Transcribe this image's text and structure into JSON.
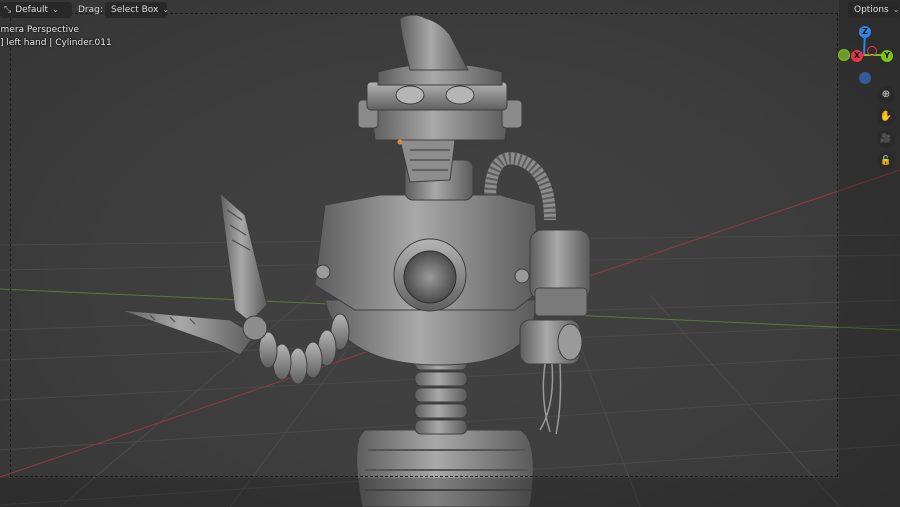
{
  "header": {
    "orientation": {
      "icon": "transform-orientation-icon",
      "label": "Default"
    },
    "drag_label": "Drag:",
    "select_mode": "Select Box",
    "options_label": "Options"
  },
  "overlay": {
    "view_name": "amera Perspective",
    "object_info": "] left hand | Cylinder.011"
  },
  "gizmo": {
    "axes": [
      {
        "label": "Z",
        "color": "#2f86e8"
      },
      {
        "label": "X",
        "color": "#e8344b"
      },
      {
        "label": "Y",
        "color": "#7fc21b"
      }
    ],
    "neg_colors": {
      "x": "#a33447",
      "y": "#6a9a2a",
      "z": "#335c99"
    }
  },
  "navigation_tools": [
    {
      "name": "zoom-icon",
      "glyph": "⊕"
    },
    {
      "name": "pan-hand-icon",
      "glyph": "✋"
    },
    {
      "name": "camera-view-icon",
      "glyph": "🎥"
    },
    {
      "name": "lock-camera-icon",
      "glyph": "🔓"
    }
  ],
  "colors": {
    "viewport_bg": "#3d3d3d",
    "x_axis_line": "#9c3c44",
    "y_axis_line": "#5e7d34",
    "model_gray": "#8a8a8a"
  }
}
